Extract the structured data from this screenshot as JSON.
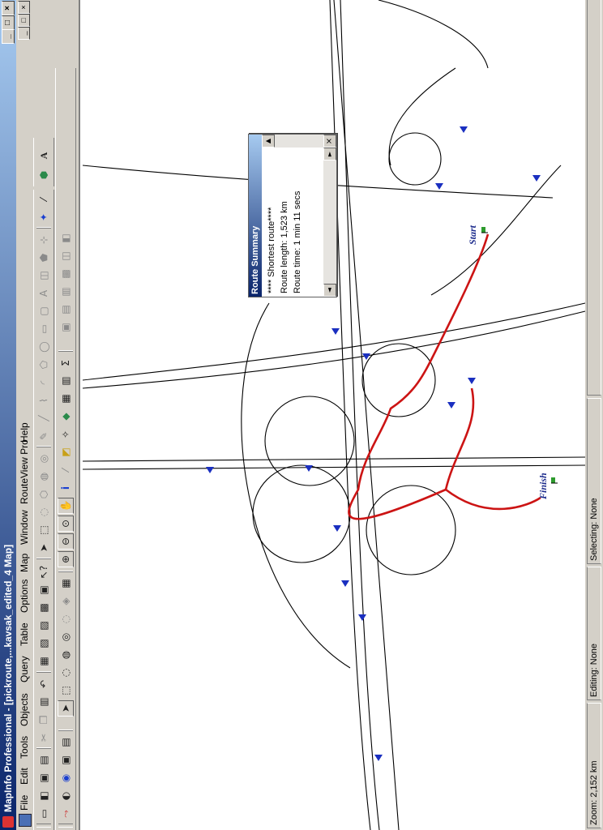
{
  "window": {
    "title": "MapInfo Professional - [pickroute,...kavsak_edited_4 Map]",
    "controls": [
      "_",
      "□",
      "×"
    ]
  },
  "menu": {
    "items": [
      "File",
      "Edit",
      "Tools",
      "Objects",
      "Query",
      "Table",
      "Options",
      "Map",
      "Window",
      "RouteView Pro",
      "Help"
    ],
    "mdi_controls": [
      "_",
      "□",
      "×"
    ]
  },
  "toolbars": {
    "icons_row1": [
      "new-icon",
      "open-icon",
      "save-icon",
      "print-icon",
      "cut-icon",
      "copy-icon",
      "paste-icon",
      "undo-icon",
      "browser-icon",
      "map-window-icon",
      "graph-icon",
      "layout-icon",
      "redistrict-icon",
      "help-pointer-icon",
      "select-icon",
      "marquee-icon",
      "radius-icon",
      "polygon-select-icon",
      "boundary-icon",
      "unselect-icon",
      "graph-select-icon",
      "info-icon",
      "label-icon",
      "drag-icon",
      "line-icon",
      "polyline-icon",
      "arc-icon",
      "polygon-icon",
      "ellipse-icon",
      "rectangle-icon",
      "rounded-rect-icon",
      "text-icon",
      "frame-icon",
      "reshape-icon",
      "add-node-icon",
      "symbol-style-icon",
      "line-style-icon",
      "region-style-icon",
      "text-style-icon"
    ],
    "icons_row2": [
      "route-icon",
      "zoom-in-icon",
      "zoom-out-icon",
      "change-view-icon",
      "grabber-icon",
      "info-tool-icon",
      "ruler-icon",
      "legend-icon",
      "statistics-icon",
      "layer-control-icon",
      "clip-icon",
      "sum-icon",
      "table-view-icon",
      "map-layers-icon",
      "graph-tool-icon",
      "layout-tool-icon"
    ]
  },
  "map": {
    "labels": {
      "start": "Start",
      "finish": "Finish"
    },
    "colors": {
      "route": "#cc1414",
      "road": "#000000",
      "arrow": "#1a2fc0",
      "flag": "#2d9b2d"
    }
  },
  "route_summary": {
    "title": "Route Summary",
    "lines": [
      "**** Shortest route****",
      "Route length: 1,523 km",
      "Route time: 1 min 11 secs"
    ]
  },
  "status": {
    "zoom": "Zoom: 2,152 km",
    "editing": "Editing: None",
    "selecting": "Selecting: None"
  }
}
